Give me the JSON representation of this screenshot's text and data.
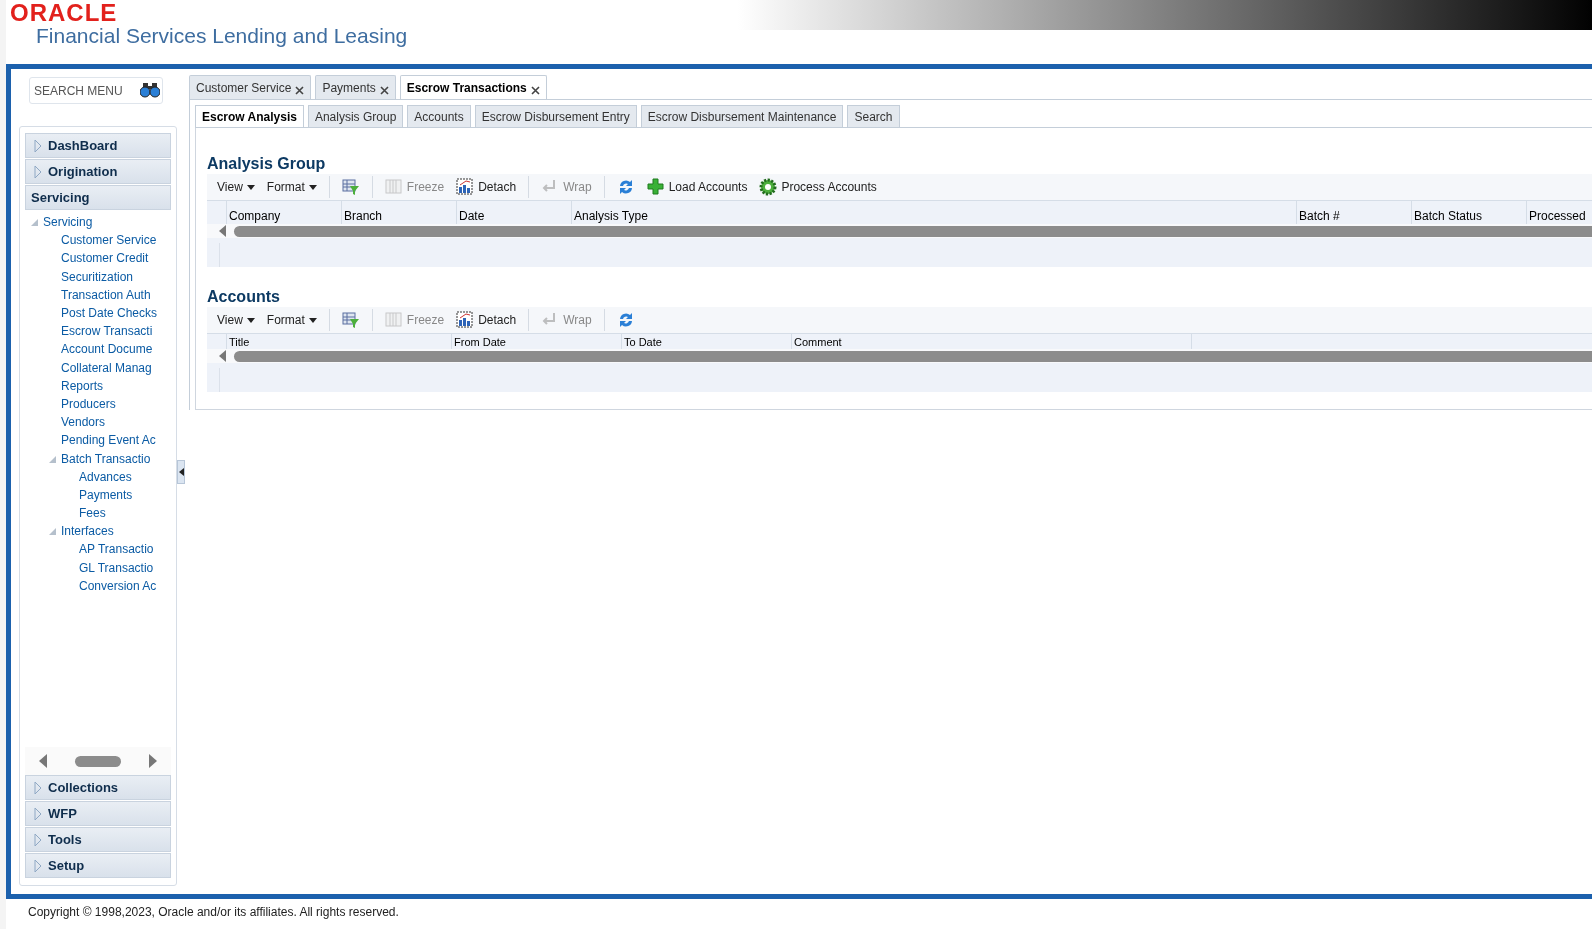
{
  "header": {
    "brand": "ORACLE",
    "product": "Financial Services Lending and Leasing"
  },
  "search": {
    "placeholder": "SEARCH MENU"
  },
  "sidebar": {
    "sections": [
      {
        "label": "DashBoard",
        "expanded": false
      },
      {
        "label": "Origination",
        "expanded": false
      },
      {
        "label": "Servicing",
        "expanded": true,
        "tree": [
          {
            "label": "Servicing",
            "expanded": true,
            "children": [
              {
                "label": "Customer Service"
              },
              {
                "label": "Customer Credit"
              },
              {
                "label": "Securitization"
              },
              {
                "label": "Transaction Auth"
              },
              {
                "label": "Post Date Checks"
              },
              {
                "label": "Escrow Transacti"
              },
              {
                "label": "Account Docume"
              },
              {
                "label": "Collateral Manag"
              },
              {
                "label": "Reports"
              },
              {
                "label": "Producers"
              },
              {
                "label": "Vendors"
              },
              {
                "label": "Pending Event Ac"
              },
              {
                "label": "Batch Transactio",
                "expanded": true,
                "children": [
                  {
                    "label": "Advances"
                  },
                  {
                    "label": "Payments"
                  },
                  {
                    "label": "Fees"
                  }
                ]
              },
              {
                "label": "Interfaces",
                "expanded": true,
                "children": [
                  {
                    "label": "AP Transactio"
                  },
                  {
                    "label": "GL Transactio"
                  },
                  {
                    "label": "Conversion Ac"
                  }
                ]
              }
            ]
          }
        ]
      },
      {
        "label": "Collections",
        "expanded": false
      },
      {
        "label": "WFP",
        "expanded": false
      },
      {
        "label": "Tools",
        "expanded": false
      },
      {
        "label": "Setup",
        "expanded": false
      }
    ]
  },
  "tabs": [
    {
      "label": "Customer Service",
      "selected": false
    },
    {
      "label": "Payments",
      "selected": false
    },
    {
      "label": "Escrow Transactions",
      "selected": true
    }
  ],
  "subtabs": [
    {
      "label": "Escrow Analysis",
      "selected": true
    },
    {
      "label": "Analysis Group",
      "selected": false
    },
    {
      "label": "Accounts",
      "selected": false
    },
    {
      "label": "Escrow Disbursement Entry",
      "selected": false
    },
    {
      "label": "Escrow Disbursement Maintenance",
      "selected": false
    },
    {
      "label": "Search",
      "selected": false
    }
  ],
  "panels": [
    {
      "title": "Analysis Group",
      "toolbar": [
        {
          "kind": "menu",
          "label": "View"
        },
        {
          "kind": "menu",
          "label": "Format"
        },
        {
          "kind": "separator"
        },
        {
          "kind": "filter"
        },
        {
          "kind": "separator"
        },
        {
          "kind": "freeze",
          "label": "Freeze",
          "disabled": true
        },
        {
          "kind": "detach",
          "label": "Detach",
          "disabled": false
        },
        {
          "kind": "separator"
        },
        {
          "kind": "wrap",
          "label": "Wrap",
          "disabled": true
        },
        {
          "kind": "separator"
        },
        {
          "kind": "refresh"
        },
        {
          "kind": "add",
          "label": "Load Accounts",
          "disabled": false
        },
        {
          "kind": "process",
          "label": "Process Accounts",
          "disabled": false
        }
      ],
      "columns": [
        "Company",
        "Branch",
        "Date",
        "Analysis Type",
        "Batch #",
        "Batch Status",
        "Processed"
      ]
    },
    {
      "title": "Accounts",
      "toolbar": [
        {
          "kind": "menu",
          "label": "View"
        },
        {
          "kind": "menu",
          "label": "Format"
        },
        {
          "kind": "separator"
        },
        {
          "kind": "filter"
        },
        {
          "kind": "separator"
        },
        {
          "kind": "freeze",
          "label": "Freeze",
          "disabled": true
        },
        {
          "kind": "detach",
          "label": "Detach",
          "disabled": false
        },
        {
          "kind": "separator"
        },
        {
          "kind": "wrap",
          "label": "Wrap",
          "disabled": true
        },
        {
          "kind": "separator"
        },
        {
          "kind": "refresh"
        }
      ],
      "columns": [
        "Title",
        "From Date",
        "To Date",
        "Comment"
      ]
    }
  ],
  "footer": {
    "copyright": "Copyright © 1998,2023, Oracle and/or its affiliates. All rights reserved."
  }
}
